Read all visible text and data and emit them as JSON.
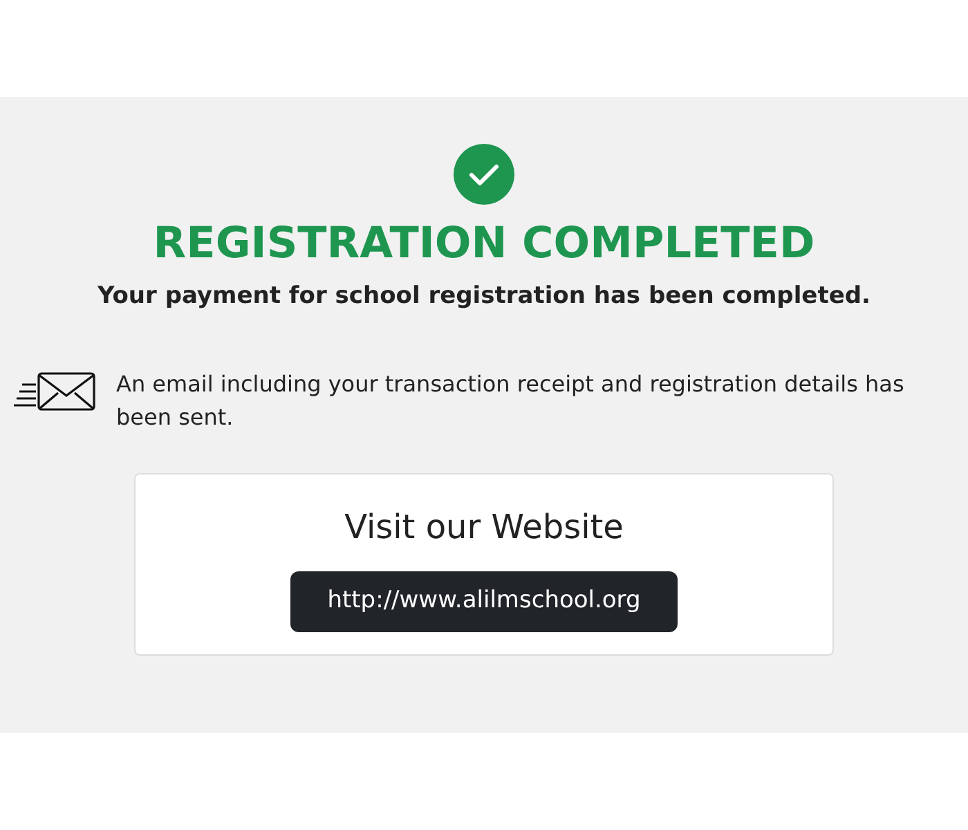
{
  "title": "REGISTRATION COMPLETED",
  "subtitle": "Your payment for school registration has been completed.",
  "email_notice": "An email including your transaction receipt and registration details has been sent.",
  "website_card": {
    "heading": "Visit our Website",
    "link": "http://www.alilmschool.org"
  }
}
